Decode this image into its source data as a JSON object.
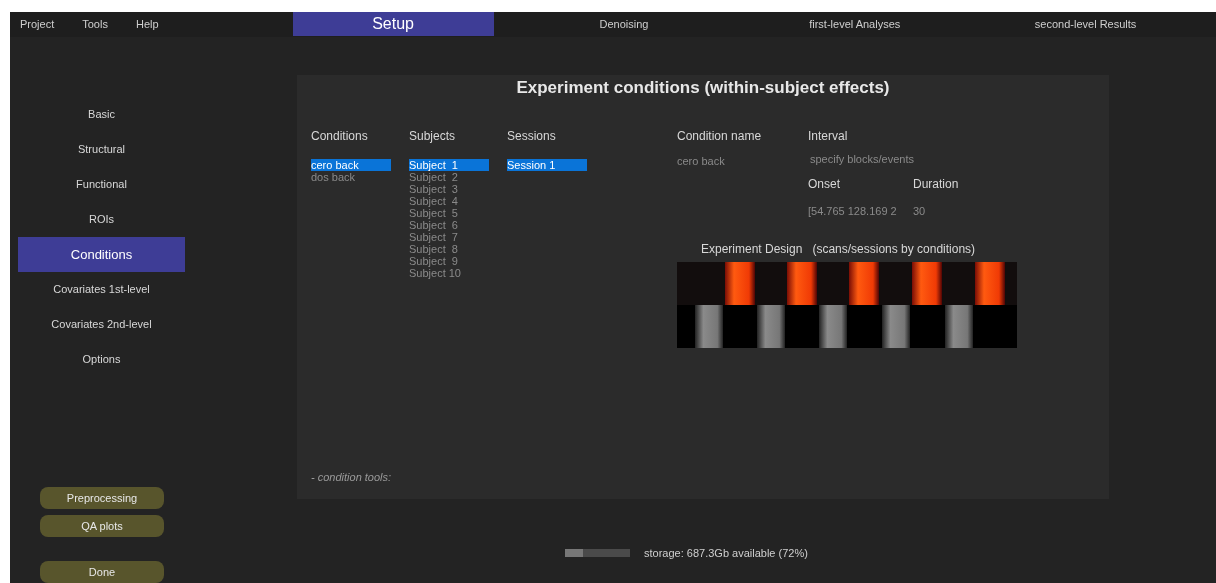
{
  "menu": [
    "Project",
    "Tools",
    "Help"
  ],
  "tabs": [
    {
      "label": "Setup",
      "selected": true
    },
    {
      "label": "Denoising",
      "selected": false
    },
    {
      "label": "first-level Analyses",
      "selected": false
    },
    {
      "label": "second-level Results",
      "selected": false
    }
  ],
  "sidebar": {
    "items": [
      {
        "label": "Basic",
        "selected": false
      },
      {
        "label": "Structural",
        "selected": false
      },
      {
        "label": "Functional",
        "selected": false
      },
      {
        "label": "ROIs",
        "selected": false
      },
      {
        "label": "Conditions",
        "selected": true
      },
      {
        "label": "Covariates 1st-level",
        "selected": false
      },
      {
        "label": "Covariates 2nd-level",
        "selected": false
      },
      {
        "label": "Options",
        "selected": false
      }
    ],
    "buttons": [
      "Preprocessing",
      "QA plots"
    ],
    "done": "Done"
  },
  "panel": {
    "title": "Experiment conditions (within-subject effects)",
    "conditions": {
      "label": "Conditions",
      "items": [
        {
          "label": "cero back",
          "selected": true
        },
        {
          "label": "dos back",
          "selected": false
        }
      ]
    },
    "subjects": {
      "label": "Subjects",
      "items": [
        {
          "label": "Subject  1",
          "selected": true
        },
        {
          "label": "Subject  2",
          "selected": false
        },
        {
          "label": "Subject  3",
          "selected": false
        },
        {
          "label": "Subject  4",
          "selected": false
        },
        {
          "label": "Subject  5",
          "selected": false
        },
        {
          "label": "Subject  6",
          "selected": false
        },
        {
          "label": "Subject  7",
          "selected": false
        },
        {
          "label": "Subject  8",
          "selected": false
        },
        {
          "label": "Subject  9",
          "selected": false
        },
        {
          "label": "Subject 10",
          "selected": false
        }
      ]
    },
    "sessions": {
      "label": "Sessions",
      "items": [
        {
          "label": "Session 1",
          "selected": true
        }
      ]
    },
    "condition_name": {
      "label": "Condition name",
      "value": "cero back"
    },
    "interval": {
      "label": "Interval",
      "value": "specify blocks/events"
    },
    "onset": {
      "label": "Onset",
      "value": "[54.765 128.169 2"
    },
    "duration": {
      "label": "Duration",
      "value": "30"
    },
    "design_title": "Experiment Design   (scans/sessions by conditions)",
    "tools": "- condition tools:"
  },
  "storage": {
    "text": "storage: 687.3Gb available (72%)",
    "level": 0.28
  }
}
